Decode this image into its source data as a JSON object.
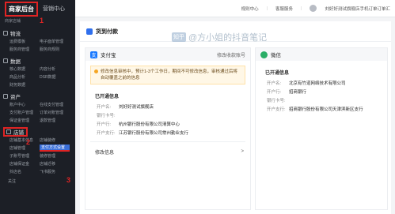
{
  "sidebar": {
    "tabs": [
      "商家后台",
      "营销中心"
    ],
    "search_label": "商家店铺",
    "groups": [
      {
        "title": "物流",
        "rows": [
          [
            "运费模板",
            "电子面单管理"
          ],
          [
            "服务商管理",
            "服务商规则"
          ]
        ]
      },
      {
        "title": "数据",
        "rows": [
          [
            "核心数据",
            "内容分析"
          ],
          [
            "商品分析",
            "DSR数据"
          ],
          [
            "财务数据",
            ""
          ]
        ]
      },
      {
        "title": "资产",
        "rows": [
          [
            "账户中心",
            "在线支付管理"
          ],
          [
            "支付账户管理",
            "订单对账管理"
          ],
          [
            "保证金管理",
            "退款管理"
          ]
        ]
      },
      {
        "title": "店铺",
        "rows": [
          [
            "店铺基本信息",
            "店铺装修"
          ],
          [
            "店铺管理",
            "支付方式设置"
          ],
          [
            "子账号管理",
            "装修管理"
          ],
          [
            "店铺保证金",
            "店铺迁移"
          ],
          [
            "抖店名",
            "飞书服务"
          ]
        ]
      }
    ],
    "bottom_label": "关注",
    "annotations": [
      "1",
      "2",
      "3"
    ]
  },
  "topbar": {
    "items": [
      "规则中心",
      "客服服务",
      "刘好好测试旗舰店手机订单订单汇"
    ]
  },
  "main": {
    "title": "货到付款",
    "watermark_logo": "知乎",
    "watermark_text": "@方小姐的抖音笔记"
  },
  "alipay": {
    "name": "支付宝",
    "action": "修改收款账号",
    "notice": "修改信息审核中，预计1-3个工作日，期间不可修改信息，审核通过后将自动覆盖之前的信息",
    "section": "已开通信息",
    "fields": [
      {
        "k": "开户名:",
        "v": "刘好好测试旗舰店"
      },
      {
        "k": "银行卡号:",
        "v": ""
      },
      {
        "k": "开户行:",
        "v": "杭州银行股份有限公司清算中心"
      },
      {
        "k": "开户支行:",
        "v": "江苏银行股份有限公司常州勤业支行"
      }
    ],
    "edit_label": "修改信息",
    "edit_link": ">"
  },
  "wechat": {
    "name": "微信",
    "section": "已开通信息",
    "fields": [
      {
        "k": "开户名:",
        "v": "北京有竹道网络技术有限公司"
      },
      {
        "k": "开户行:",
        "v": "招商银行"
      },
      {
        "k": "银行卡号:",
        "v": ""
      },
      {
        "k": "开户支行:",
        "v": "招商银行股份有限公司天津滨新区支行"
      }
    ]
  }
}
